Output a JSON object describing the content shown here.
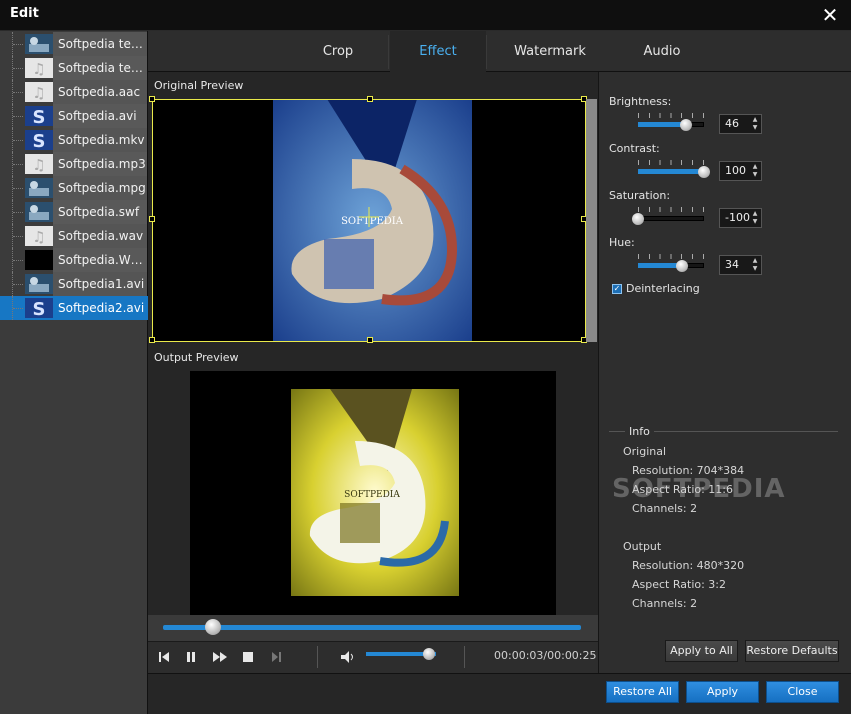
{
  "window": {
    "title": "Edit"
  },
  "files": [
    {
      "name": "Softpedia test ...",
      "thumb": "video-frame"
    },
    {
      "name": "Softpedia test....",
      "thumb": "music-note"
    },
    {
      "name": "Softpedia.aac",
      "thumb": "music-note"
    },
    {
      "name": "Softpedia.avi",
      "thumb": "softpedia-s"
    },
    {
      "name": "Softpedia.mkv",
      "thumb": "softpedia-s"
    },
    {
      "name": "Softpedia.mp3",
      "thumb": "music-note"
    },
    {
      "name": "Softpedia.mpg",
      "thumb": "video-frame"
    },
    {
      "name": "Softpedia.swf",
      "thumb": "video-frame"
    },
    {
      "name": "Softpedia.wav",
      "thumb": "music-note"
    },
    {
      "name": "Softpedia.WMV",
      "thumb": "black"
    },
    {
      "name": "Softpedia1.avi",
      "thumb": "video-frame"
    },
    {
      "name": "Softpedia2.avi",
      "thumb": "softpedia-s"
    }
  ],
  "selected_file_index": 11,
  "tabs": [
    {
      "label": "Crop"
    },
    {
      "label": "Effect"
    },
    {
      "label": "Watermark"
    },
    {
      "label": "Audio"
    }
  ],
  "active_tab": "Effect",
  "preview": {
    "original_label": "Original Preview",
    "output_label": "Output Preview",
    "seek_fraction": 0.12,
    "volume_fraction": 0.9,
    "timecode": "00:00:03/00:00:25"
  },
  "effects": {
    "brightness": {
      "label": "Brightness:",
      "value": "46",
      "fraction": 0.73
    },
    "contrast": {
      "label": "Contrast:",
      "value": "100",
      "fraction": 1.0
    },
    "saturation": {
      "label": "Saturation:",
      "value": "-100",
      "fraction": 0.0
    },
    "hue": {
      "label": "Hue:",
      "value": "34",
      "fraction": 0.67
    },
    "deinterlacing": {
      "label": "Deinterlacing",
      "checked": true
    }
  },
  "info": {
    "title": "Info",
    "original": {
      "heading": "Original",
      "resolution": "Resolution: 704*384",
      "aspect": "Aspect Ratio: 11:6",
      "channels": "Channels: 2"
    },
    "output": {
      "heading": "Output",
      "resolution": "Resolution: 480*320",
      "aspect": "Aspect Ratio: 3:2",
      "channels": "Channels: 2"
    }
  },
  "buttons": {
    "apply_all": "Apply to All",
    "restore_defaults": "Restore Defaults",
    "restore_all": "Restore All",
    "apply": "Apply",
    "close": "Close"
  },
  "watermark_text": "SOFTPEDIA",
  "colors": {
    "accent": "#2488d4",
    "selected": "#1777c4",
    "tab_active": "#4ab0f0",
    "crop_border": "#e9e94a"
  }
}
